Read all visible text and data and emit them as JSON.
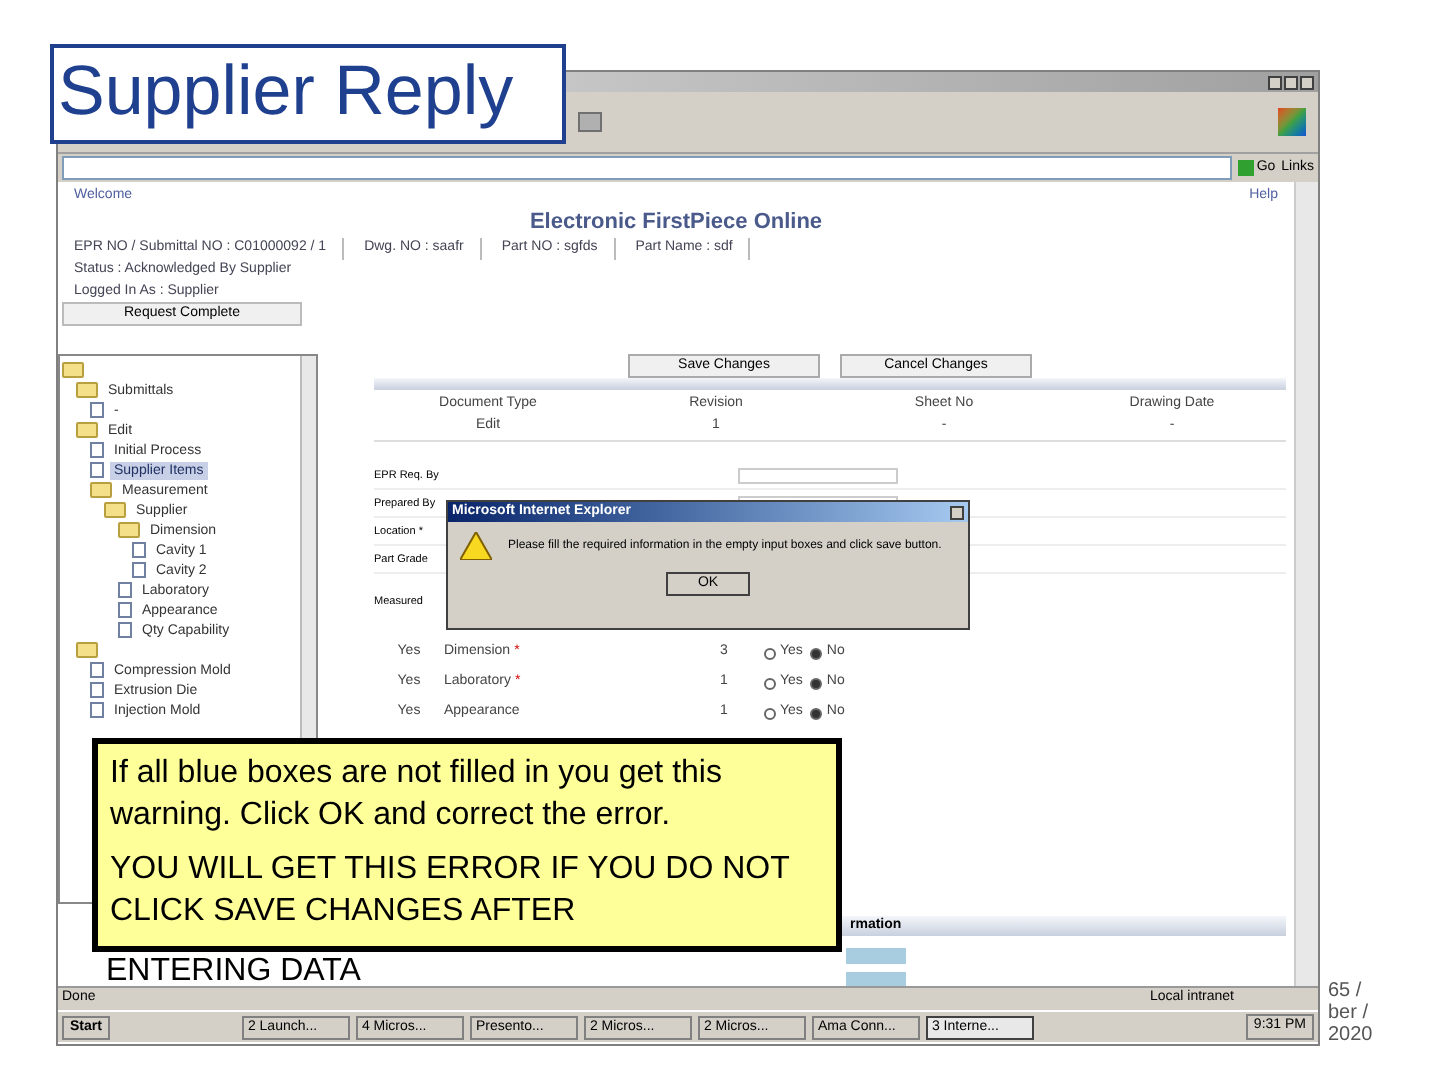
{
  "slide_title": "Supplier Reply",
  "browser": {
    "links_label": "Links",
    "go_label": "Go"
  },
  "page": {
    "welcome": "Welcome",
    "help": "Help",
    "title": "Electronic FirstPiece Online",
    "info": [
      "EPR NO / Submittal NO : C01000092 / 1",
      "Dwg. NO : saafr",
      "Part NO : sgfds",
      "Part Name : sdf"
    ],
    "status": "Status : Acknowledged By Supplier",
    "logged_in": "Logged In As : Supplier",
    "request_button": "Request Complete"
  },
  "tree": [
    {
      "kind": "folder",
      "expanded": true,
      "children": [
        {
          "kind": "folder",
          "label": "Submittals",
          "expanded": true,
          "children": [
            {
              "kind": "doc",
              "label": "-",
              "selected": false
            }
          ]
        },
        {
          "kind": "folder",
          "label": "Edit",
          "expanded": true,
          "children": [
            {
              "kind": "doc",
              "label": "Initial Process",
              "selected": false
            },
            {
              "kind": "doc",
              "label": "Supplier Items",
              "selected": true
            },
            {
              "kind": "folder",
              "label": "Measurement",
              "expanded": true,
              "children": [
                {
                  "kind": "folder",
                  "label": "Supplier",
                  "expanded": true,
                  "children": [
                    {
                      "kind": "folder",
                      "label": "Dimension",
                      "expanded": true,
                      "children": [
                        {
                          "kind": "doc",
                          "label": "Cavity 1",
                          "selected": false
                        },
                        {
                          "kind": "doc",
                          "label": "Cavity 2",
                          "selected": false
                        }
                      ]
                    },
                    {
                      "kind": "doc",
                      "label": "Laboratory",
                      "selected": false
                    },
                    {
                      "kind": "doc",
                      "label": "Appearance",
                      "selected": false
                    },
                    {
                      "kind": "doc",
                      "label": "Qty Capability",
                      "selected": false
                    }
                  ]
                }
              ]
            }
          ]
        },
        {
          "kind": "folder",
          "expanded": true,
          "children": [
            {
              "kind": "doc",
              "label": "Compression Mold",
              "selected": false
            },
            {
              "kind": "doc",
              "label": "Extrusion Die",
              "selected": false
            },
            {
              "kind": "doc",
              "label": "Injection Mold",
              "selected": false
            }
          ]
        }
      ]
    }
  ],
  "actions": [
    "Save Changes",
    "Cancel Changes"
  ],
  "documents": {
    "columns": [
      "Document Type",
      "Revision",
      "Sheet No",
      "Drawing Date"
    ],
    "rows": [
      [
        "Edit",
        "1",
        "-",
        "-"
      ]
    ]
  },
  "fields": [
    "EPR Req. By",
    "Prepared By",
    "Location *",
    "Part Grade"
  ],
  "requirement_label": "Measured",
  "requirements": [
    {
      "flag": "Yes",
      "name": "Dimension",
      "mark": "*",
      "qty": "3",
      "options": [
        {
          "label": "Yes",
          "selected": false
        },
        {
          "label": "No",
          "selected": true
        }
      ]
    },
    {
      "flag": "Yes",
      "name": "Laboratory",
      "mark": "*",
      "qty": "1",
      "options": [
        {
          "label": "Yes",
          "selected": false
        },
        {
          "label": "No",
          "selected": true
        }
      ]
    },
    {
      "flag": "Yes",
      "name": "Appearance",
      "qty": "1",
      "options": [
        {
          "label": "Yes",
          "selected": false
        },
        {
          "label": "No",
          "selected": true
        }
      ]
    }
  ],
  "section_title": "rmation",
  "dialog": {
    "title": "Microsoft Internet Explorer",
    "message": "Please fill the required information in the empty input boxes and click save button.",
    "button": "OK"
  },
  "callout": {
    "lines": [
      "If all blue boxes are not filled in you get this warning.  Click OK and correct the error.",
      "YOU WILL GET THIS ERROR IF YOU DO NOT CLICK SAVE CHANGES AFTER"
    ],
    "trailing": "ENTERING DATA"
  },
  "status_bar": {
    "left": "Done",
    "zone": "Local intranet"
  },
  "taskbar": {
    "start": "Start",
    "tasks": [
      {
        "label": "2 Launch...",
        "selected": false
      },
      {
        "label": "4 Micros...",
        "selected": false
      },
      {
        "label": "Presento...",
        "selected": false
      },
      {
        "label": "2 Micros...",
        "selected": false
      },
      {
        "label": "2 Micros...",
        "selected": false
      },
      {
        "label": "Ama Conn...",
        "selected": false
      },
      {
        "label": "3 Interne...",
        "selected": true
      }
    ],
    "clock": "9:31 PM"
  },
  "footer": [
    "65 /",
    "ber /",
    "2020"
  ]
}
